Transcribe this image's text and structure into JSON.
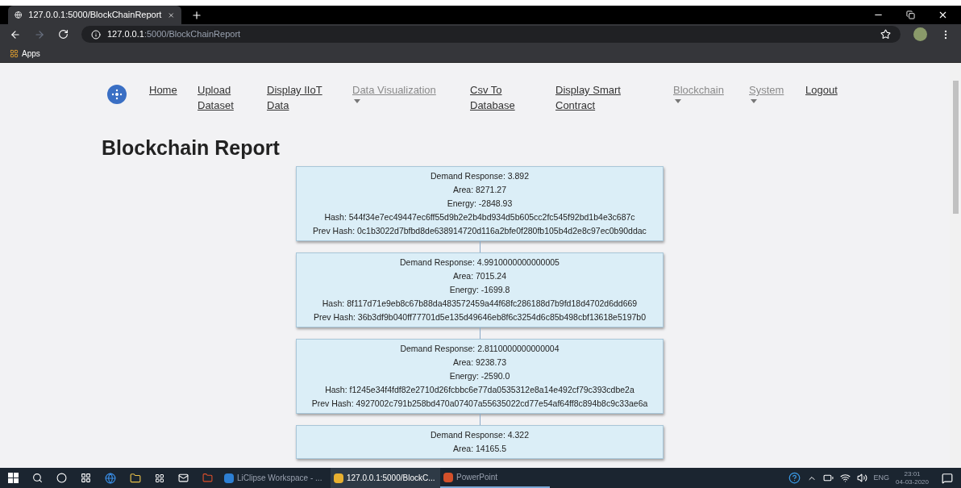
{
  "browser": {
    "tab_title": "127.0.0.1:5000/BlockChainReport",
    "url_host": "127.0.0.1",
    "url_rest": ":5000/BlockChainReport",
    "bookmarks": [
      "Apps"
    ]
  },
  "nav": [
    {
      "label": "Home",
      "dropdown": false
    },
    {
      "label": "Upload Dataset",
      "dropdown": false
    },
    {
      "label": "Display IIoT Data",
      "dropdown": false
    },
    {
      "label": "Data Visualization",
      "dropdown": true
    },
    {
      "label": "Csv To Database",
      "dropdown": false
    },
    {
      "label": "Display Smart Contract",
      "dropdown": false
    },
    {
      "label": "Blockchain",
      "dropdown": true
    },
    {
      "label": "System",
      "dropdown": true
    },
    {
      "label": "Logout",
      "dropdown": false
    }
  ],
  "page_title": "Blockchain Report",
  "blocks": [
    {
      "lines": [
        "Demand Response: 3.892",
        "Area: 8271.27",
        "Energy: -2848.93",
        "Hash: 544f34e7ec49447ec6ff55d9b2e2b4bd934d5b605cc2fc545f92bd1b4e3c687c",
        "Prev Hash: 0c1b3022d7bfbd8de638914720d116a2bfe0f280fb105b4d2e8c97ec0b90ddac"
      ]
    },
    {
      "lines": [
        "Demand Response: 4.9910000000000005",
        "Area: 7015.24",
        "Energy: -1699.8",
        "Hash: 8f117d71e9eb8c67b88da483572459a44f68fc286188d7b9fd18d4702d6dd669",
        "Prev Hash: 36b3df9b040ff77701d5e135d49646eb8f6c3254d6c85b498cbf13618e5197b0"
      ]
    },
    {
      "lines": [
        "Demand Response: 2.8110000000000004",
        "Area: 9238.73",
        "Energy: -2590.0",
        "Hash: f1245e34f4fdf82e2710d26fcbbc6e77da0535312e8a14e492cf79c393cdbe2a",
        "Prev Hash: 4927002c791b258bd470a07407a55635022cd77e54af64ff8c894b8c9c33ae6a"
      ]
    },
    {
      "lines": [
        "Demand Response: 4.322",
        "Area: 14165.5"
      ]
    }
  ],
  "taskbar": {
    "apps": [
      {
        "label": "LiClipse Workspace - ...",
        "selected": false
      },
      {
        "label": "127.0.0.1:5000/BlockC...",
        "selected": true
      },
      {
        "label": "PowerPoint",
        "selected": false
      }
    ],
    "language": "ENG",
    "time": "23:01",
    "date": "04-03-2020"
  }
}
